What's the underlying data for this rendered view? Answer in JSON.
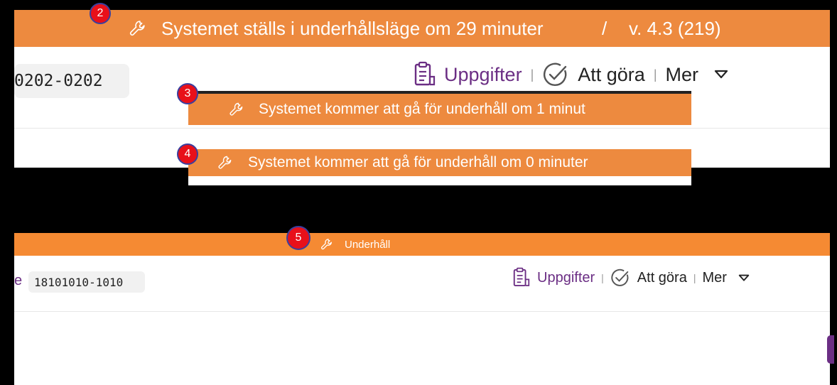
{
  "badges": {
    "b2": "2",
    "b3": "3",
    "b4": "4",
    "b5": "5"
  },
  "top_banner": {
    "text": "Systemet ställs i  underhållsläge om 29 minuter",
    "separator": "/",
    "version": "v. 4.3 (219)"
  },
  "panel1": {
    "id_value": "0202-0202",
    "nav": {
      "tasks_label": "Uppgifter",
      "todo_label": "Att göra",
      "more_label": "Mer",
      "separator": "|"
    }
  },
  "banner3": {
    "text": "Systemet kommer att gå för underhåll om 1 minut"
  },
  "banner4": {
    "text": "Systemet kommer att gå för underhåll om 0 minuter"
  },
  "panel2": {
    "banner_text": "Underhåll",
    "id_prefix": "e",
    "id_value": "18101010-1010",
    "nav": {
      "tasks_label": "Uppgifter",
      "todo_label": "Att göra",
      "more_label": "Mer",
      "separator": "|"
    }
  },
  "colors": {
    "banner_orange": "#ED8A3F",
    "banner_orange_bright": "#F58A33",
    "badge_red": "#E8101A",
    "badge_border": "#3A3F9E",
    "nav_purple": "#6B2E84",
    "text_dark": "#3A1F4F"
  },
  "icons": [
    "wrench-icon",
    "clipboard-icon",
    "check-circle-icon",
    "chevron-down-icon"
  ]
}
